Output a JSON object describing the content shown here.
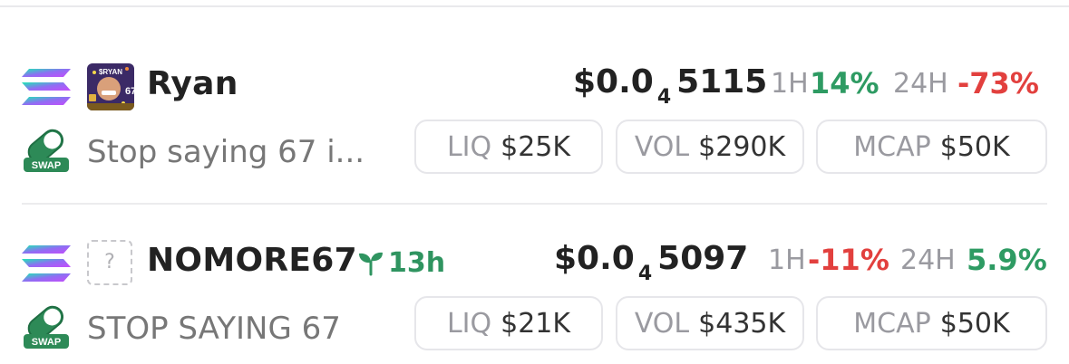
{
  "tokens": [
    {
      "name": "Ryan",
      "description": "Stop saying 67 i...",
      "age": "",
      "price_prefix": "$0.0",
      "price_zeros": "4",
      "price_digits": "5115",
      "change_1h_label": "1H",
      "change_1h": "14%",
      "change_24h_label": "24H",
      "change_24h": "-73%",
      "liq_label": "LIQ",
      "liq": "$25K",
      "vol_label": "VOL",
      "vol": "$290K",
      "mcap_label": "MCAP",
      "mcap": "$50K",
      "swap_badge": "SWAP"
    },
    {
      "name": "NOMORE67",
      "description": "STOP SAYING 67",
      "age": "13h",
      "avatar_placeholder": "?",
      "price_prefix": "$0.0",
      "price_zeros": "4",
      "price_digits": "5097",
      "change_1h_label": "1H",
      "change_1h": "-11%",
      "change_24h_label": "24H",
      "change_24h": "5.9%",
      "liq_label": "LIQ",
      "liq": "$21K",
      "vol_label": "VOL",
      "vol": "$435K",
      "mcap_label": "MCAP",
      "mcap": "$50K",
      "swap_badge": "SWAP"
    }
  ],
  "avatar_text": {
    "top": "$RYAN",
    "side": "67"
  },
  "icons": {
    "chain": "solana-icon",
    "swap": "swap-pill-icon",
    "age": "seedling-icon"
  },
  "colors": {
    "up": "#2e9b63",
    "down": "#e2403e",
    "muted": "#9a9aa0",
    "border": "#e6e6ea"
  }
}
